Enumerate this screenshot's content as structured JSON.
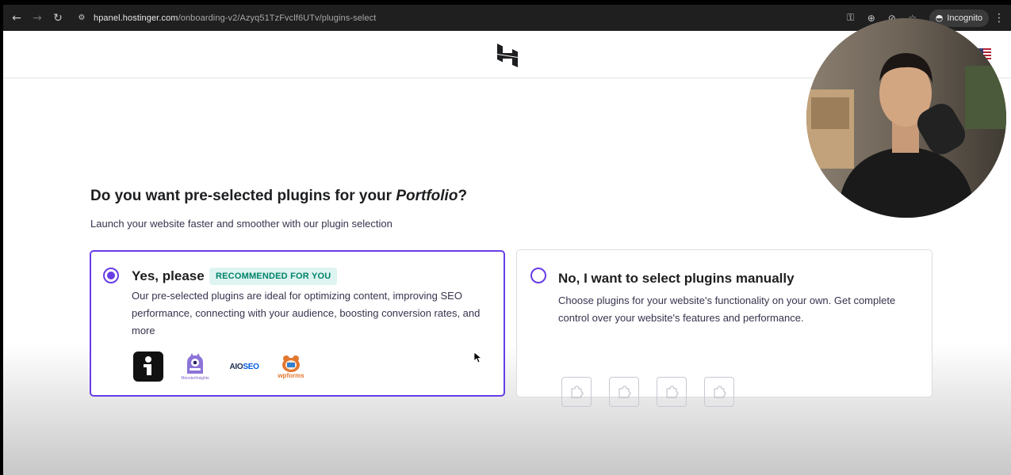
{
  "browser": {
    "url_host": "hpanel.hostinger.com",
    "url_path": "/onboarding-v2/Azyq51TzFvclf6UTv/plugins-select",
    "incognito_label": "Incognito"
  },
  "header": {
    "logo_icon": "hostinger-logo",
    "flag_icon": "us-flag-icon"
  },
  "question": {
    "title_prefix": "Do you want pre-selected plugins for your ",
    "title_emphasis": "Portfolio",
    "title_suffix": "?",
    "subtitle": "Launch your website faster and smoother with our plugin selection"
  },
  "options": {
    "yes": {
      "label": "Yes, please",
      "badge": "RECOMMENDED FOR YOU",
      "description": "Our pre-selected plugins are ideal for optimizing content, improving SEO performance, connecting with your audience, boosting conversion rates, and more",
      "selected": true,
      "plugins": [
        "info-plugin-icon",
        "monsterinsights-logo",
        "aioseo-logo",
        "wpforms-logo"
      ],
      "monster_caption": "MonsterInsights",
      "aioseo_text_a": "AIO",
      "aioseo_text_b": "SEO",
      "wpforms_caption": "wpforms"
    },
    "no": {
      "label": "No, I want to select plugins manually",
      "description": "Choose plugins for your website's functionality on your own. Get complete control over your website's features and performance.",
      "selected": false,
      "placeholder_count": 4
    }
  },
  "colors": {
    "accent": "#673de6",
    "badge_bg": "#def4f0",
    "badge_text": "#00836a",
    "text_dark": "#1d1e20"
  }
}
